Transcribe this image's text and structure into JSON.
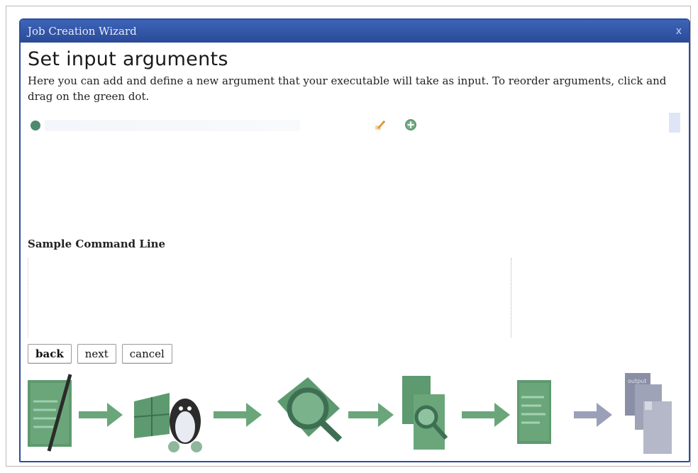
{
  "window": {
    "title": "Job Creation Wizard",
    "close_label": "x"
  },
  "page": {
    "heading": "Set input arguments",
    "description": "Here you can add and define a new argument that your executable will take as input. To reorder arguments, click and drag on the green dot."
  },
  "arguments": {
    "icons": [
      "drag-handle-dot",
      "edit-pencil-icon",
      "add-plus-icon"
    ]
  },
  "command_line": {
    "label": "Sample Command Line",
    "value": ""
  },
  "buttons": {
    "back": "back",
    "next": "next",
    "cancel": "cancel"
  },
  "workflow": {
    "steps": [
      "describe-document",
      "platform-select",
      "inspect-arguments",
      "review-files",
      "settings-document",
      "output-files"
    ],
    "step_labels": {
      "output": "output"
    }
  },
  "colors": {
    "titlebar": "#2a4a98",
    "accent_green": "#5e9a6f",
    "dot_green": "#4f8a6e",
    "arrow_gray": "#9aa0b8"
  }
}
